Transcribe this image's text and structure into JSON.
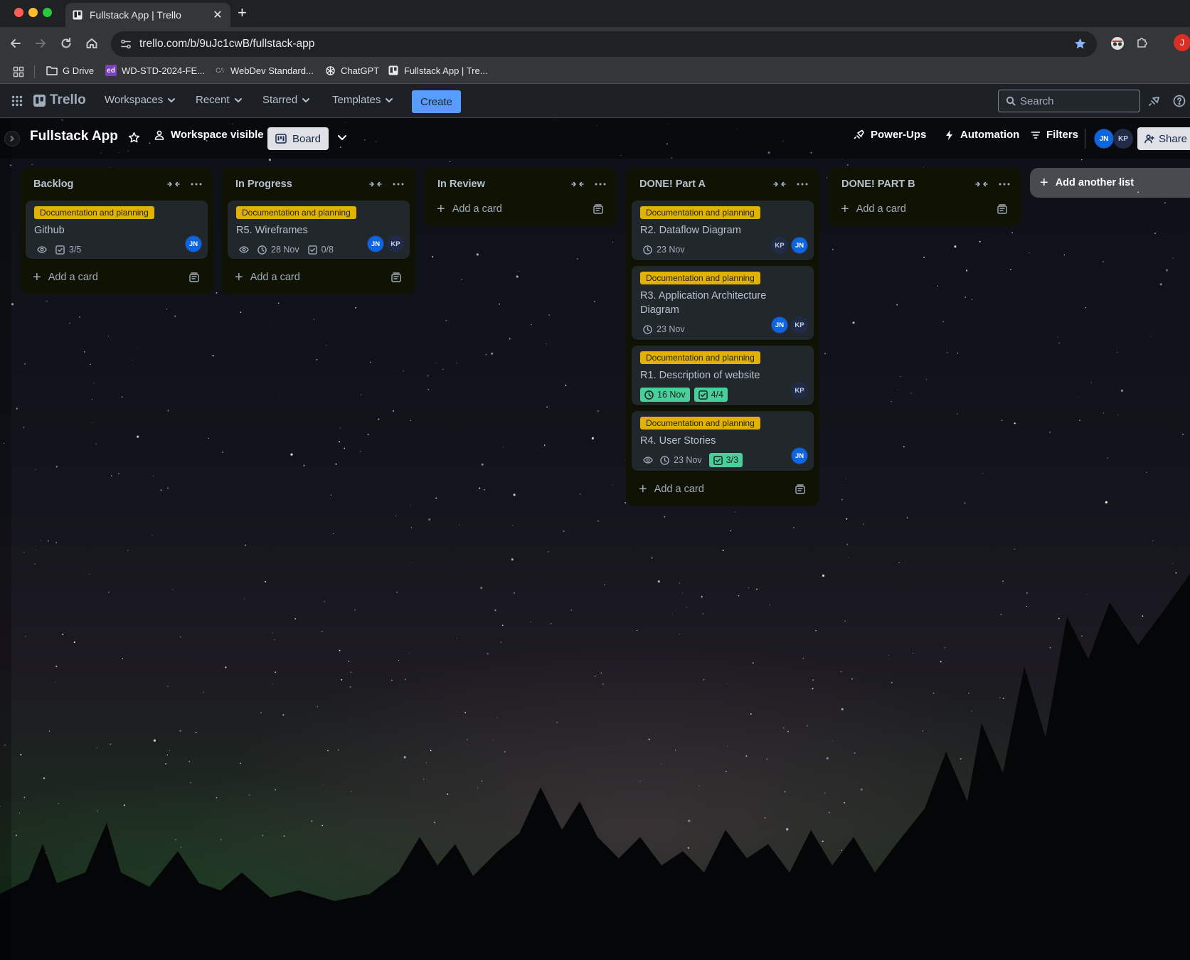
{
  "browser": {
    "tab_title": "Fullstack App | Trello",
    "url": "trello.com/b/9uJc1cwB/fullstack-app",
    "profile_initial": "J",
    "bookmarks": [
      "G Drive",
      "WD-STD-2024-FE...",
      "WebDev Standard...",
      "ChatGPT",
      "Fullstack App | Tre..."
    ]
  },
  "header": {
    "logo": "Trello",
    "nav": [
      "Workspaces",
      "Recent",
      "Starred",
      "Templates"
    ],
    "create_label": "Create",
    "search_placeholder": "Search"
  },
  "boardbar": {
    "title": "Fullstack App",
    "visibility": "Workspace visible",
    "view": "Board",
    "powerups": "Power-Ups",
    "automation": "Automation",
    "filters": "Filters",
    "members": [
      "JN",
      "KP"
    ],
    "share": "Share"
  },
  "lists": [
    {
      "title": "Backlog",
      "cards": [
        {
          "label": "Documentation and planning",
          "title": "Github",
          "watch": true,
          "checklist": "3/5",
          "members": [
            "JN"
          ]
        }
      ],
      "add_card": "Add a card"
    },
    {
      "title": "In Progress",
      "cards": [
        {
          "label": "Documentation and planning",
          "title": "R5. Wireframes",
          "watch": true,
          "due": "28 Nov",
          "checklist": "0/8",
          "members": [
            "JN",
            "KP"
          ]
        }
      ],
      "add_card": "Add a card"
    },
    {
      "title": "In Review",
      "cards": [],
      "add_card": "Add a card"
    },
    {
      "title": "DONE! Part A",
      "cards": [
        {
          "label": "Documentation and planning",
          "title": "R2. Dataflow Diagram",
          "due": "23 Nov",
          "members": [
            "KP",
            "JN"
          ]
        },
        {
          "label": "Documentation and planning",
          "title": "R3. Application Architecture Diagram",
          "due": "23 Nov",
          "members": [
            "JN",
            "KP"
          ]
        },
        {
          "label": "Documentation and planning",
          "title": "R1. Description of website",
          "due": "16 Nov",
          "due_complete": true,
          "checklist": "4/4",
          "checklist_complete": true,
          "members": [
            "KP"
          ]
        },
        {
          "label": "Documentation and planning",
          "title": "R4. User Stories",
          "watch": true,
          "due": "23 Nov",
          "checklist": "3/3",
          "checklist_complete": true,
          "members": [
            "JN"
          ]
        }
      ],
      "add_card": "Add a card"
    },
    {
      "title": "DONE! PART B",
      "cards": [],
      "add_card": "Add a card"
    }
  ],
  "add_another_list": "Add another list",
  "colors": {
    "label_yellow": "#e2b203",
    "complete_green": "#4bce97",
    "create_blue": "#579dff",
    "member_jn": "#0c66e4"
  }
}
